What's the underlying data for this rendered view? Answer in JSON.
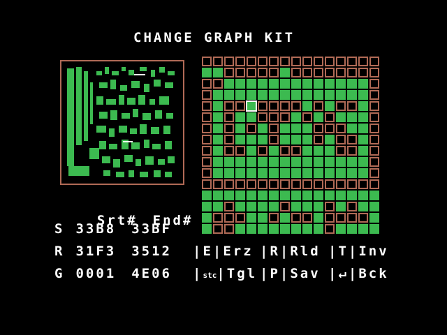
{
  "title": "CHANGE GRAPH KIT",
  "colors": {
    "on": "#3cba50",
    "off": "#b06a56",
    "text": "#ffffff",
    "background": "#000000"
  },
  "header": {
    "start": "Srt#",
    "end": "End#"
  },
  "rows": [
    {
      "label": "S",
      "start": "33B8",
      "end": "33BF"
    },
    {
      "label": "R",
      "start": "31F3",
      "end": "3512"
    },
    {
      "label": "G",
      "start": "0001",
      "end": "4E06"
    }
  ],
  "commands": [
    [
      {
        "key": "E",
        "action": "Erz"
      },
      {
        "key": "R",
        "action": "Rld"
      },
      {
        "key": "T",
        "action": "Inv"
      }
    ],
    [
      {
        "key": "stc",
        "action": "Tgl"
      },
      {
        "key": "P",
        "action": "Sav"
      },
      {
        "key": "↵",
        "action": "Bck"
      }
    ]
  ],
  "grid_pattern": [
    "0000000000000000",
    "1100000100000000",
    "0011111111111110",
    "0111111111111110",
    "0100100001010010",
    "0101100010101110",
    "0101010111000110",
    "0101110111010010",
    "0100101001110010",
    "0111111111111110",
    "0111111111111110",
    "0000000000000000",
    "1111111111111111",
    "1101111011101011",
    "1000110100100001",
    "1001111111101111"
  ],
  "cursor": {
    "row": 4,
    "col": 4
  }
}
